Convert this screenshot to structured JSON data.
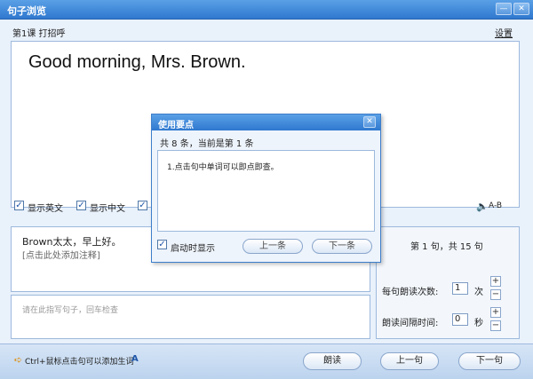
{
  "window": {
    "title": "句子浏览",
    "min_label": "—",
    "close_label": "✕"
  },
  "lesson": {
    "title": "第1课 打招呼",
    "settings_label": "设置"
  },
  "english": {
    "sentence": "Good morning, Mrs. Brown."
  },
  "options": [
    {
      "label": "显示英文",
      "checked": true
    },
    {
      "label": "显示中文",
      "checked": true
    },
    {
      "label": "显",
      "checked": true
    }
  ],
  "audio": {
    "speaker_glyph": "🔈",
    "ab_label": "A-B"
  },
  "chinese": {
    "sentence": "Brown太太，早上好。",
    "note_hint": "[点击此处添加注释]"
  },
  "input": {
    "placeholder": "请在此指写句子，回车检查"
  },
  "stats": {
    "sentence_info": "第 1 句，共 15 句",
    "repeat_label": "每句朗读次数:",
    "repeat_value": "1",
    "repeat_unit": "次",
    "interval_label": "朗读间隔时间:",
    "interval_value": "0",
    "interval_unit": "秒",
    "plus": "+",
    "minus": "−"
  },
  "status": {
    "tip_icon": "arrow-icon",
    "tip_glyph": "➪",
    "tip": "Ctrl+鼠标点击句可以添加生词",
    "tip_a": "A",
    "read_label": "朗读",
    "prev_label": "上一句",
    "next_label": "下一句"
  },
  "dialog": {
    "title": "使用要点",
    "close_label": "✕",
    "count": "共 8 条，当前是第 1 条",
    "tip": "1.点击句中单词可以即点即查。",
    "startup_label": "启动时显示",
    "startup_checked": true,
    "prev_label": "上一条",
    "next_label": "下一条"
  },
  "check_glyph": "✓"
}
